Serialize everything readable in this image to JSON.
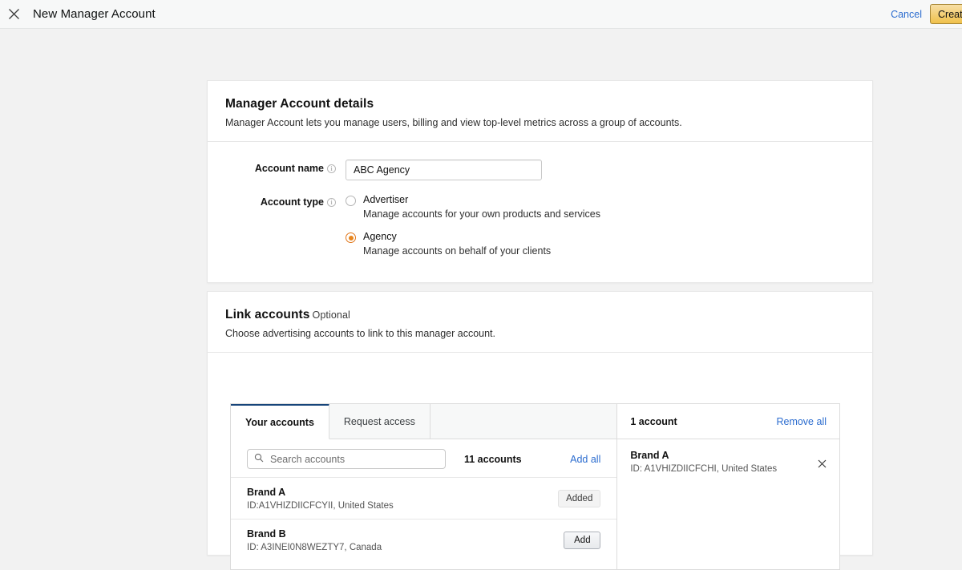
{
  "topbar": {
    "close_icon": "close-icon",
    "title": "New Manager Account",
    "cancel_label": "Cancel",
    "create_label": "Create"
  },
  "details_card": {
    "title": "Manager Account details",
    "subtitle": "Manager Account lets you manage users, billing and view top-level metrics across a group of accounts.",
    "account_name": {
      "label": "Account name",
      "info_icon": "info-icon",
      "value": "ABC Agency",
      "placeholder": ""
    },
    "account_type": {
      "label": "Account type",
      "info_icon": "info-icon",
      "options": [
        {
          "title": "Advertiser",
          "description": "Manage accounts for your own products and services",
          "selected": false
        },
        {
          "title": "Agency",
          "description": "Manage accounts on behalf of your clients",
          "selected": true
        }
      ]
    }
  },
  "link_card": {
    "title": "Link accounts",
    "optional": "Optional",
    "subtitle": "Choose advertising accounts to link to this manager account."
  },
  "link_panel": {
    "tabs": [
      {
        "label": "Your accounts",
        "active": true
      },
      {
        "label": "Request access",
        "active": false
      }
    ],
    "search": {
      "icon": "search-icon",
      "placeholder": "Search accounts",
      "value": ""
    },
    "account_count": "11 accounts",
    "add_all_label": "Add all",
    "accounts": [
      {
        "name": "Brand A",
        "id": "ID:A1VHIZDIICFCYII, United States",
        "action_label": "Added",
        "added": true
      },
      {
        "name": "Brand B",
        "id": "ID: A3INEI0N8WEZTY7, Canada",
        "action_label": "Add",
        "added": false
      }
    ],
    "selected": {
      "count_label": "1 account",
      "remove_all_label": "Remove all",
      "items": [
        {
          "name": "Brand A",
          "id": "ID: A1VHIZDIICFCHI, United States",
          "remove_icon": "close-icon"
        }
      ]
    }
  },
  "colors": {
    "page_background": "#f2f2f2",
    "card_background": "#ffffff",
    "link_blue": "#2b6ccf",
    "accent_orange": "#e8861e",
    "active_tab_border": "#17457a",
    "create_button": "#f0c14b"
  }
}
